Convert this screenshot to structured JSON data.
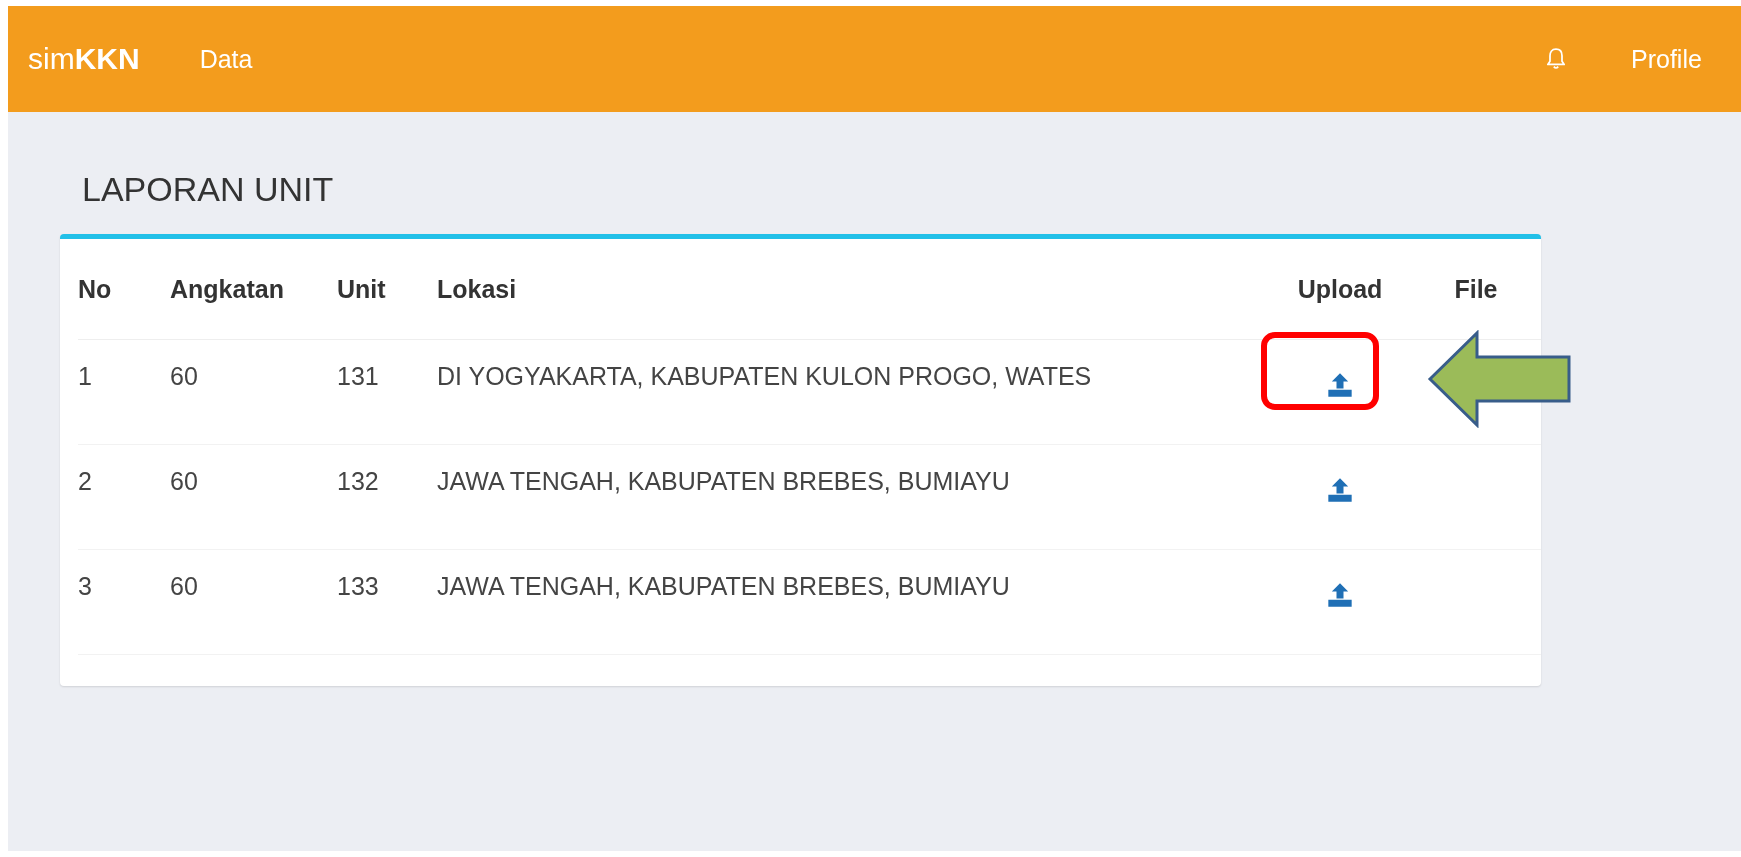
{
  "navbar": {
    "brand": "sim**KKN**",
    "links": [
      "Data"
    ],
    "profile": "Profile"
  },
  "page": {
    "title": "LAPORAN UNIT"
  },
  "table": {
    "columns": [
      "No",
      "Angkatan",
      "Unit",
      "Lokasi",
      "Upload",
      "File"
    ],
    "rows": [
      {
        "no": "1",
        "angkatan": "60",
        "unit": "131",
        "lokasi": "DI YOGYAKARTA, KABUPATEN KULON PROGO, WATES",
        "highlighted": true
      },
      {
        "no": "2",
        "angkatan": "60",
        "unit": "132",
        "lokasi": "JAWA TENGAH, KABUPATEN BREBES, BUMIAYU",
        "highlighted": false
      },
      {
        "no": "3",
        "angkatan": "60",
        "unit": "133",
        "lokasi": "JAWA TENGAH, KABUPATEN BREBES, BUMIAYU",
        "highlighted": false
      }
    ]
  }
}
